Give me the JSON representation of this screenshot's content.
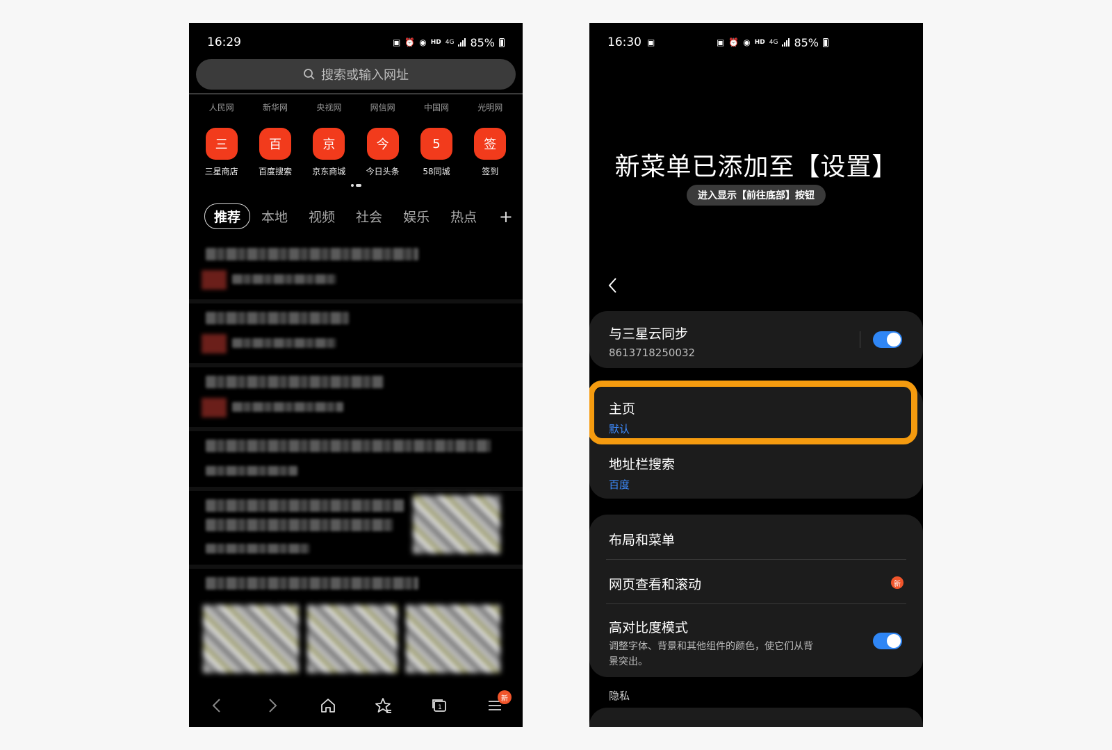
{
  "left": {
    "status": {
      "time": "16:29",
      "battery": "85%",
      "hd": "HD",
      "net": "4G"
    },
    "search_placeholder": "搜索或输入网址",
    "site_tabs": [
      "人民网",
      "新华网",
      "央视网",
      "网信网",
      "中国网",
      "光明网"
    ],
    "shortcuts": [
      {
        "glyph": "三",
        "label": "三星商店"
      },
      {
        "glyph": "百",
        "label": "百度搜索"
      },
      {
        "glyph": "京",
        "label": "京东商城"
      },
      {
        "glyph": "今",
        "label": "今日头条"
      },
      {
        "glyph": "5",
        "label": "58同城"
      },
      {
        "glyph": "签",
        "label": "签到"
      }
    ],
    "categories": [
      "推荐",
      "本地",
      "视频",
      "社会",
      "娱乐",
      "热点"
    ],
    "add_category": "+",
    "bottom_nav": {
      "icons": [
        "back-icon",
        "forward-icon",
        "home-icon",
        "bookmark-icon",
        "tabs-icon",
        "menu-icon"
      ],
      "tab_count": "1",
      "menu_badge": "新"
    },
    "colors": {
      "shortcut_red": "#f23b1c",
      "badge": "#f0552b"
    }
  },
  "right": {
    "status": {
      "time": "16:30",
      "battery": "85%",
      "hd": "HD",
      "net": "4G"
    },
    "title": "新菜单已添加至【设置】",
    "hint": "进入显示【前往底部】按钮",
    "sync": {
      "title": "与三星云同步",
      "account": "8613718250032",
      "enabled": true
    },
    "homepage": {
      "title": "主页",
      "value": "默认"
    },
    "address_search": {
      "title": "地址栏搜索",
      "value": "百度"
    },
    "layout_menu": "布局和菜单",
    "page_view": {
      "title": "网页查看和滚动",
      "badge": "新"
    },
    "high_contrast": {
      "title": "高对比度模式",
      "desc_line1": "调整字体、背景和其他组件的颜色，使它们从背",
      "desc_line2": "景突出。",
      "enabled": true
    },
    "privacy_label": "隐私",
    "colors": {
      "highlight": "#f59b0f",
      "link_blue": "#3d8bff",
      "toggle_on": "#2f86f5"
    }
  }
}
